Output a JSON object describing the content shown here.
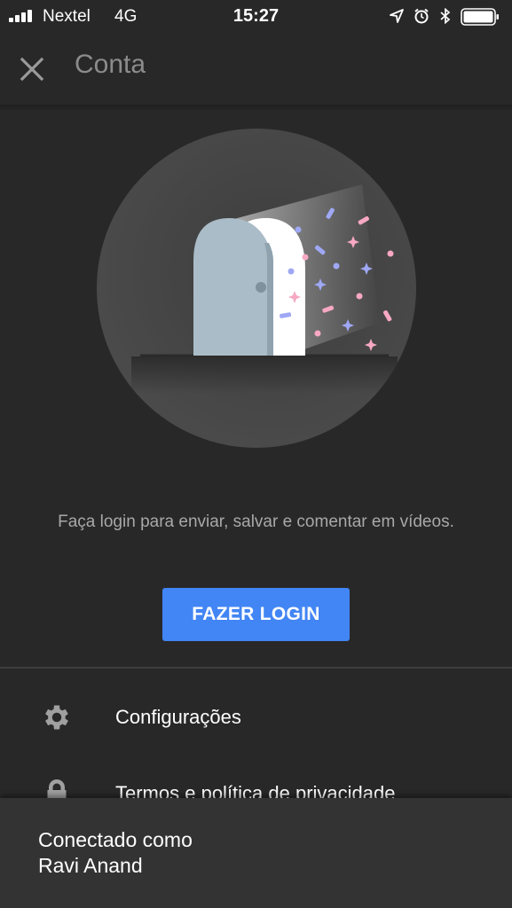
{
  "status_bar": {
    "carrier": "Nextel",
    "network": "4G",
    "time": "15:27",
    "icons": [
      "signal-icon",
      "location-arrow-icon",
      "alarm-icon",
      "bluetooth-icon",
      "battery-icon"
    ]
  },
  "header": {
    "title": "Conta",
    "close_icon": "close-icon"
  },
  "main": {
    "illustration": "door-confetti-illustration",
    "message": "Faça login para enviar, salvar e comentar em vídeos.",
    "login_button": "FAZER LOGIN"
  },
  "menu": {
    "items": [
      {
        "label": "Configurações",
        "icon": "gear-icon"
      },
      {
        "label": "Termos e política de privacidade",
        "icon": "lock-icon"
      }
    ]
  },
  "account": {
    "connected_label": "Conectado como",
    "user_name": "Ravi Anand"
  },
  "colors": {
    "background": "#282828",
    "accent": "#4285f4",
    "bottom_panel": "#333333"
  }
}
